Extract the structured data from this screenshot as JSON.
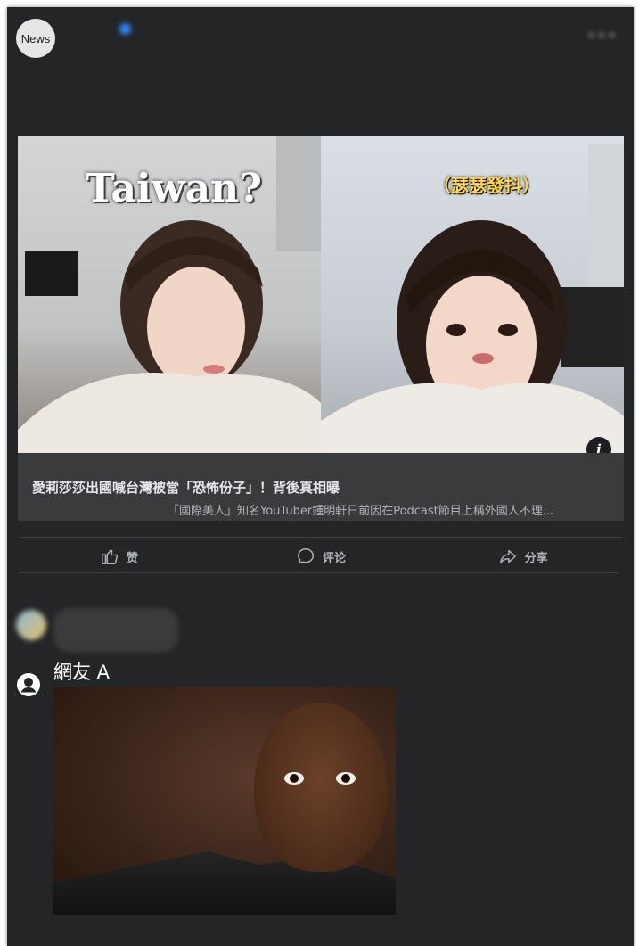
{
  "post": {
    "avatar_text": "News",
    "page_name": "",
    "meta": "",
    "text": "",
    "text_link": "",
    "more_icon": "more-horizontal-icon"
  },
  "link_card": {
    "thumb_caption_left": "Taiwan?",
    "thumb_caption_right": "（瑟瑟發抖）",
    "title": "愛莉莎莎出國喊台灣被當「恐怖份子」！背後真相曝",
    "description": "「國際美人」知名YouTuber鍾明軒日前因在Podcast節目上稱外國人不理..."
  },
  "actions": {
    "like": "赞",
    "comment": "评论",
    "share": "分享"
  },
  "comments": {
    "sort_label": "",
    "first": {
      "name": "",
      "text": ""
    }
  },
  "reply": {
    "name": "網友 A",
    "icon": "user-avatar-icon"
  },
  "colors": {
    "card_bg": "#242526",
    "text_primary": "#e4e6eb",
    "text_secondary": "#b0b3b8",
    "link": "#4599ff",
    "verified": "#2d88ff"
  }
}
